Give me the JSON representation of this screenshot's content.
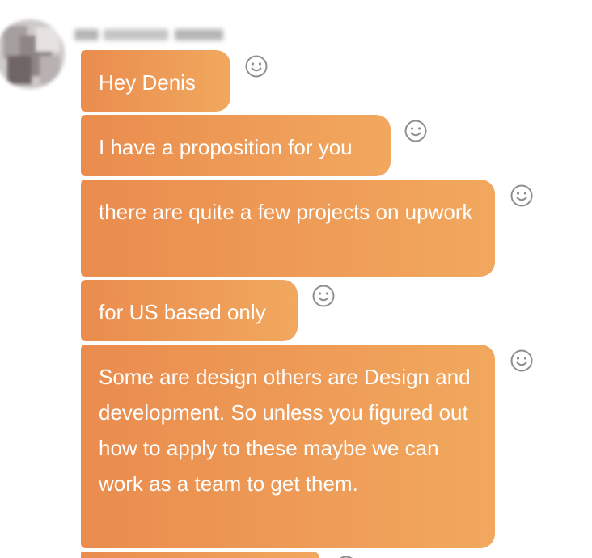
{
  "sender": {
    "name_hidden": true
  },
  "messages": [
    {
      "text": "Hey Denis"
    },
    {
      "text": "I have a proposition for you"
    },
    {
      "text": "there are quite a few projects on upwork"
    },
    {
      "text": "for US based only"
    },
    {
      "text": "Some are design others are Design and development. So unless you figured out how to apply to these maybe we can work as a team to get them."
    },
    {
      "text": ""
    }
  ],
  "icons": {
    "reaction": "smiley-face-icon",
    "avatar": "blurred-profile-photo"
  },
  "colors": {
    "bubble_start": "#ea8c4e",
    "bubble_end": "#f1a85e",
    "bubble_text": "#ffffff",
    "reaction_icon": "#8e8e8e"
  }
}
